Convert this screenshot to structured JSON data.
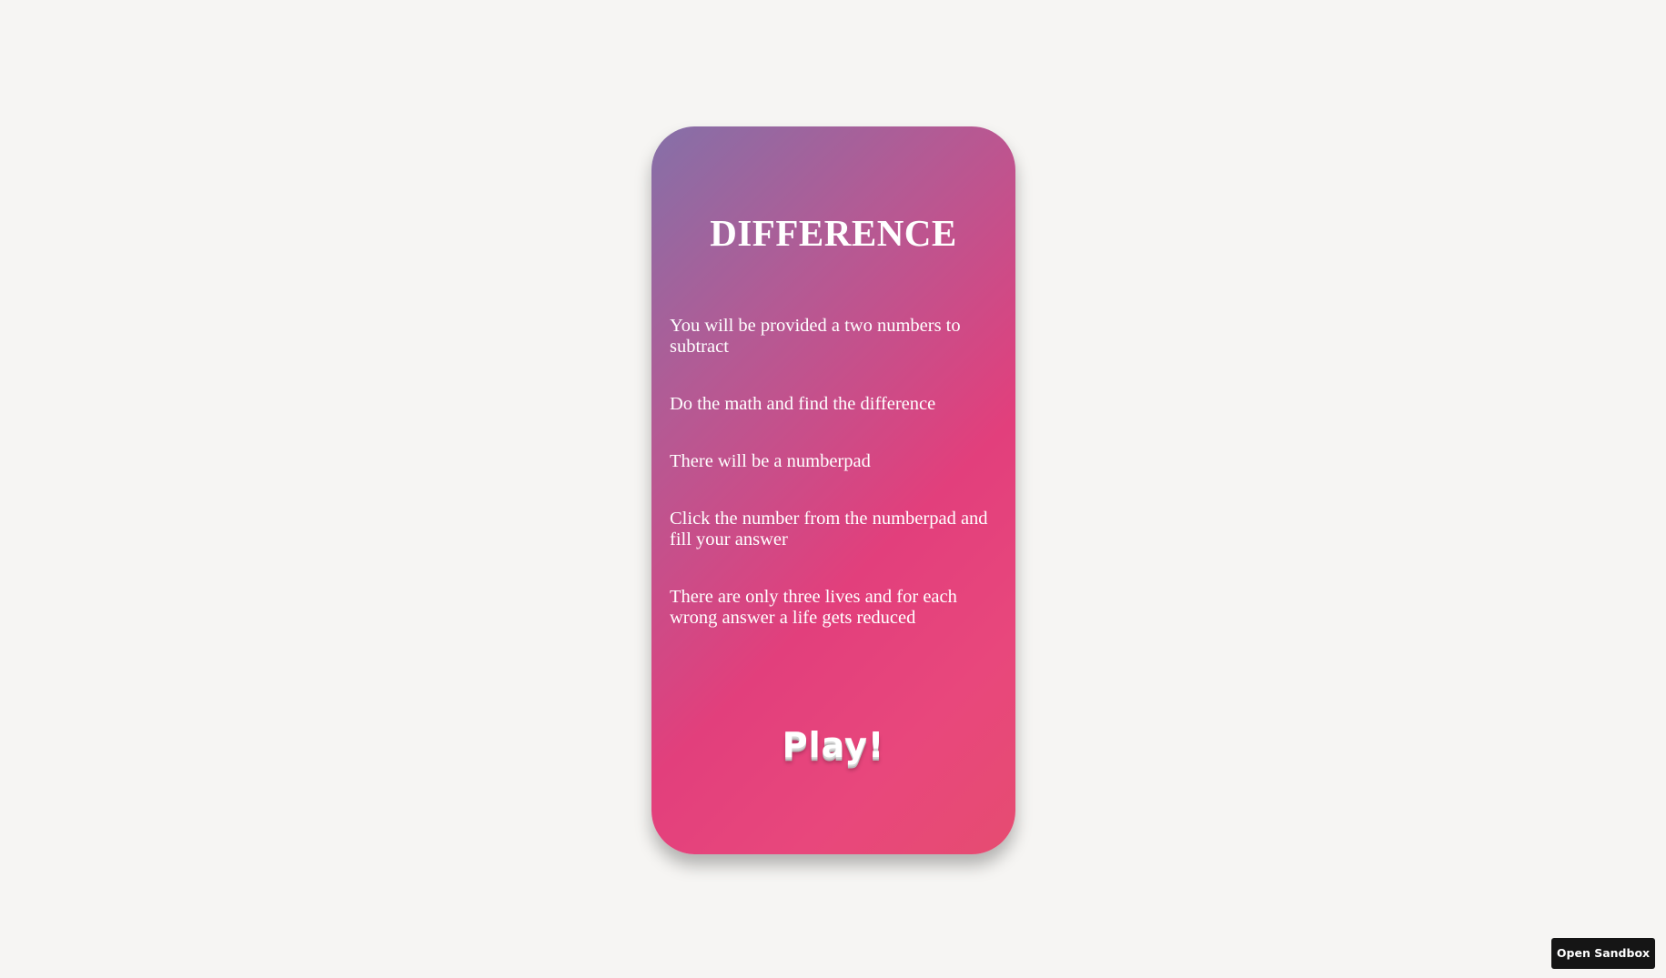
{
  "game": {
    "title": "DIFFERENCE",
    "rules": [
      "You will be provided a two numbers to subtract",
      "Do the math and find the difference",
      "There will be a numberpad",
      "Click the number from the numberpad and fill your answer",
      "There are only three lives and for each wrong answer a life gets reduced"
    ],
    "play_label": "Play!"
  },
  "sandbox": {
    "button_label": "Open Sandbox"
  },
  "colors": {
    "page_background": "#f6f5f3",
    "card_gradient_start": "#8570a8",
    "card_gradient_end": "#e64c71",
    "sandbox_button": "#151515"
  }
}
